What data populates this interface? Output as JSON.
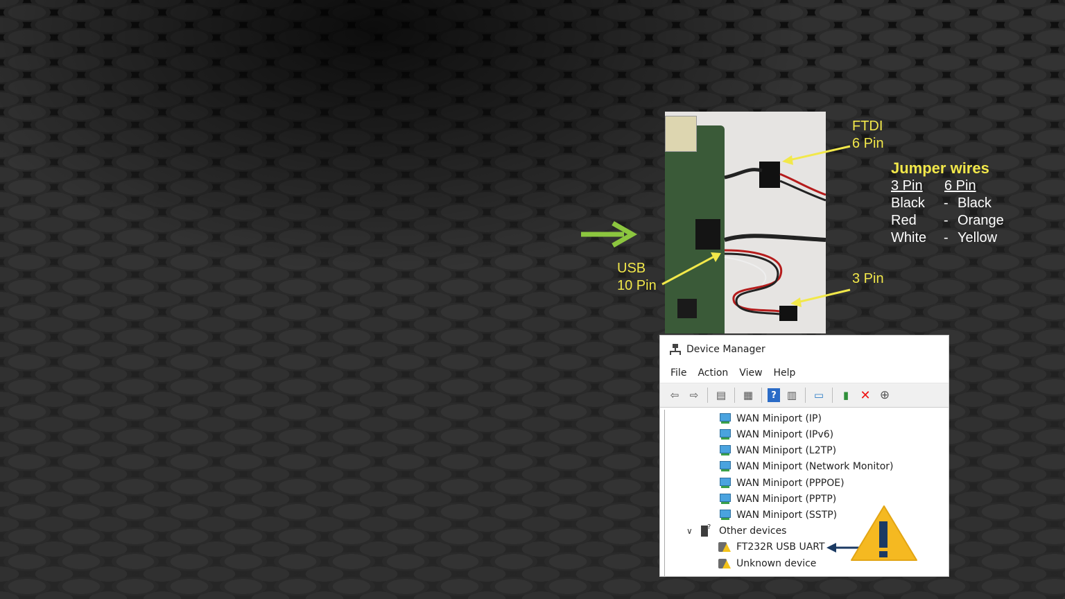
{
  "labels": {
    "ftdi": "FTDI\n6 Pin",
    "usb": "USB\n10 Pin",
    "pin3": "3 Pin"
  },
  "jumper": {
    "title": "Jumper wires",
    "header": [
      "3 Pin",
      "6 Pin"
    ],
    "rows": [
      {
        "a": "Black",
        "sep": "-",
        "b": "Black"
      },
      {
        "a": "Red",
        "sep": "-",
        "b": "Orange"
      },
      {
        "a": "White",
        "sep": "-",
        "b": "Yellow"
      }
    ]
  },
  "device_manager": {
    "title": "Device Manager",
    "menu": [
      "File",
      "Action",
      "View",
      "Help"
    ],
    "toolbar_icons": [
      "back-arrow-icon",
      "forward-arrow-icon",
      "properties-icon",
      "show-hidden-icon",
      "help-icon",
      "update-icon",
      "monitor-icon",
      "add-driver-icon",
      "uninstall-icon",
      "download-icon"
    ],
    "tree": [
      {
        "label": "WAN Miniport (IP)",
        "icon": "network-adapter-icon"
      },
      {
        "label": "WAN Miniport (IPv6)",
        "icon": "network-adapter-icon"
      },
      {
        "label": "WAN Miniport (L2TP)",
        "icon": "network-adapter-icon"
      },
      {
        "label": "WAN Miniport (Network Monitor)",
        "icon": "network-adapter-icon"
      },
      {
        "label": "WAN Miniport (PPPOE)",
        "icon": "network-adapter-icon"
      },
      {
        "label": "WAN Miniport (PPTP)",
        "icon": "network-adapter-icon"
      },
      {
        "label": "WAN Miniport (SSTP)",
        "icon": "network-adapter-icon"
      },
      {
        "label": "Other devices",
        "icon": "other-devices-icon"
      },
      {
        "label": "FT232R USB UART",
        "icon": "warning-device-icon"
      },
      {
        "label": "Unknown device",
        "icon": "warning-device-icon"
      }
    ]
  },
  "colors": {
    "label_yellow": "#f2e84a",
    "green_arrow": "#8cc63f",
    "warning_yellow": "#f5b921",
    "warning_mark": "#1b3a63"
  }
}
